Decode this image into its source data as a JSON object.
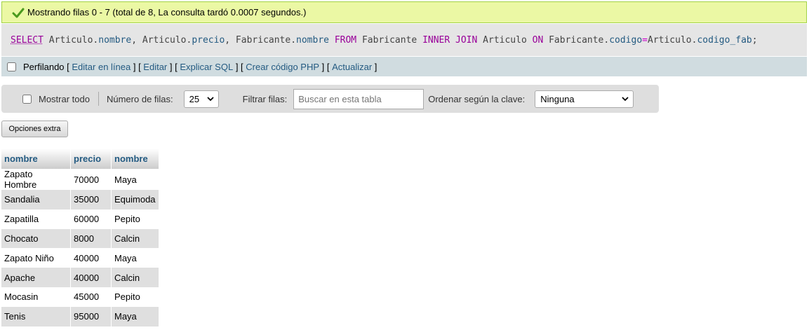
{
  "status": {
    "message": "Mostrando filas 0 - 7 (total de 8, La consulta tardó 0.0007 segundos.)",
    "icon": "check-icon",
    "color": "#ebf8a4"
  },
  "sql": {
    "select": "SELECT",
    "t1": " Articulo.",
    "c1": "nombre",
    "t2": ", Articulo.",
    "c2": "precio",
    "t3": ", Fabricante.",
    "c3": "nombre",
    "from": " FROM",
    "t4": " Fabricante ",
    "inner": "INNER",
    "t5": " ",
    "join": "JOIN",
    "t6": " Articulo ",
    "on": "ON",
    "t7": " Fabricante.",
    "c4": "codigo",
    "eq": "=",
    "t8": "Articulo.",
    "c5": "codigo_fab",
    "end": ";"
  },
  "profiling": {
    "label": "Perfilando",
    "links": {
      "inline_edit": "Editar en línea",
      "edit": "Editar",
      "explain": "Explicar SQL",
      "php": "Crear código PHP",
      "refresh": "Actualizar"
    }
  },
  "nav": {
    "show_all": "Mostrar todo",
    "rows_label": "Número de filas:",
    "rows_value": "25",
    "filter_label": "Filtrar filas:",
    "filter_placeholder": "Buscar en esta tabla",
    "sort_label": "Ordenar según la clave:",
    "sort_value": "Ninguna"
  },
  "extra_options": "Opciones extra",
  "table": {
    "headers": [
      "nombre",
      "precio",
      "nombre"
    ],
    "rows": [
      [
        "Zapato Hombre",
        "70000",
        "Maya"
      ],
      [
        "Sandalia",
        "35000",
        "Equimoda"
      ],
      [
        "Zapatilla",
        "60000",
        "Pepito"
      ],
      [
        "Chocato",
        "8000",
        "Calcin"
      ],
      [
        "Zapato Niño",
        "40000",
        "Maya"
      ],
      [
        "Apache",
        "40000",
        "Calcin"
      ],
      [
        "Mocasin",
        "45000",
        "Pepito"
      ],
      [
        "Tenis",
        "95000",
        "Maya"
      ]
    ]
  }
}
